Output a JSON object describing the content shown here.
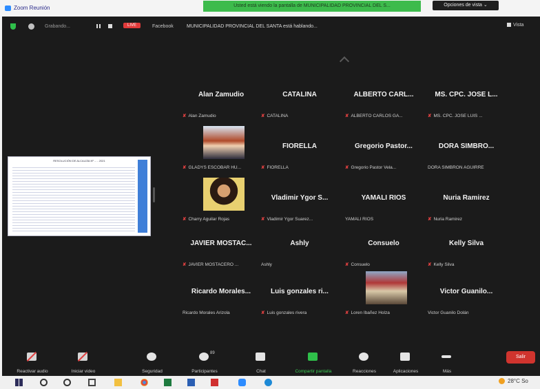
{
  "window": {
    "title": "Zoom Reunión"
  },
  "banner": {
    "sharing_text": "Usted está viendo la pantalla de MUNICIPALIDAD PROVINCIAL DEL S...",
    "view_options": "Opciones de vista ⌄"
  },
  "meeting_bar": {
    "recording_label": "Grabando...",
    "live_badge": "LIVE",
    "platform": "Facebook",
    "speaking": "MUNICIPALIDAD PROVINCIAL DEL SANTA está hablando...",
    "view_label": "Vista"
  },
  "shared_screen": {
    "doc_title": "RESOLUCIÓN DE ALCALDÍA Nº ... - 2021"
  },
  "participants": [
    {
      "name": "Alan Zamudio",
      "sub": "Alan Zamudio",
      "muted": true
    },
    {
      "name": "CATALINA",
      "sub": "CATALINA",
      "muted": true
    },
    {
      "name": "ALBERTO CARL...",
      "sub": "ALBERTO CARLOS GA...",
      "muted": true
    },
    {
      "name": "MS. CPC. JOSE L...",
      "sub": "MS. CPC. JOSE LUIS ...",
      "muted": true
    },
    {
      "name": "",
      "sub": "GLADYS ESCOBAR HU...",
      "muted": true,
      "photo": "portrait-woman"
    },
    {
      "name": "FIORELLA",
      "sub": "FIORELLA",
      "muted": true
    },
    {
      "name": "Gregorio Pastor...",
      "sub": "Gregorio Pastor Vela...",
      "muted": true
    },
    {
      "name": "DORA SIMBRO...",
      "sub": "DORA SIMBRON AGUIRRE",
      "muted": false
    },
    {
      "name": "",
      "sub": "Charry Aguilar Rojas",
      "muted": true,
      "photo": "portrait-woman-curly"
    },
    {
      "name": "Vladimir Ygor S...",
      "sub": "Vladimir Ygor Suarez...",
      "muted": true
    },
    {
      "name": "YAMALI RIOS",
      "sub": "YAMALI RIOS",
      "muted": false
    },
    {
      "name": "Nuria Ramirez",
      "sub": "Nuria Ramirez",
      "muted": true
    },
    {
      "name": "JAVIER MOSTAC...",
      "sub": "JAVIER MOSTACERO ...",
      "muted": true
    },
    {
      "name": "Ashly",
      "sub": "Ashly",
      "muted": false
    },
    {
      "name": "Consuelo",
      "sub": "Consuelo",
      "muted": true
    },
    {
      "name": "Kelly Silva",
      "sub": "Kelly Silva",
      "muted": true
    },
    {
      "name": "Ricardo Morales...",
      "sub": "Ricardo Morales Arizola",
      "muted": false
    },
    {
      "name": "Luis gonzales ri...",
      "sub": "Luis gonzales rivera",
      "muted": true
    },
    {
      "name": "",
      "sub": "Loren Ibañez Holza",
      "muted": true,
      "photo": "landscape"
    },
    {
      "name": "Victor Guanilo...",
      "sub": "Victor Guanilo Dolán",
      "muted": false
    }
  ],
  "toolbar": {
    "audio": "Reactivar audio",
    "video": "Iniciar video",
    "security": "Seguridad",
    "participants": "Participantes",
    "participants_count": "89",
    "chat": "Chat",
    "share": "Compartir pantalla",
    "reactions": "Reacciones",
    "apps": "Aplicaciones",
    "more": "Más",
    "leave": "Salir"
  },
  "taskbar": {
    "weather": "28°C  So"
  }
}
